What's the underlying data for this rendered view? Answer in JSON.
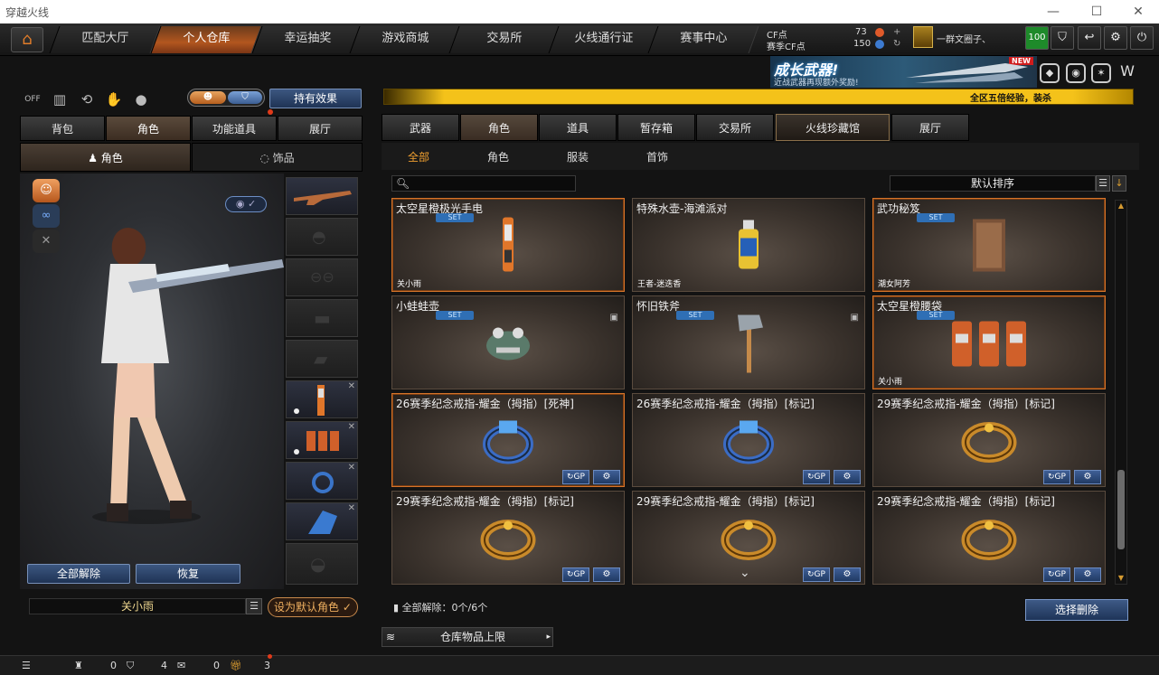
{
  "window": {
    "title": "穿越火线"
  },
  "nav": {
    "tabs": [
      "匹配大厅",
      "个人仓库",
      "幸运抽奖",
      "游戏商城",
      "交易所",
      "火线通行证",
      "赛事中心"
    ],
    "active": 1
  },
  "currency": {
    "cf_label": "CF点",
    "cf_value": "73",
    "season_label": "赛季CF点",
    "season_value": "150"
  },
  "user": {
    "name": "一群文圈子、",
    "level": "100"
  },
  "banner": {
    "title": "成长武器!",
    "subtitle": "近战武器再现额外奖励!",
    "badge": "NEW"
  },
  "marquee": {
    "text": "全区五倍经验，装杀"
  },
  "left": {
    "toggle_off": "OFF",
    "effects_button": "持有效果",
    "tabs": [
      "背包",
      "角色",
      "功能道具",
      "展厅"
    ],
    "active_tab": 1,
    "subtabs": [
      "角色",
      "饰品"
    ],
    "clear_all": "全部解除",
    "restore": "恢复",
    "character_name": "关小雨",
    "set_default": "设为默认角色"
  },
  "right": {
    "tabs": [
      "武器",
      "角色",
      "道具",
      "暂存箱",
      "交易所",
      "火线珍藏馆",
      "展厅"
    ],
    "active_tab": 1,
    "filters": [
      "全部",
      "角色",
      "服装",
      "首饰"
    ],
    "active_filter": 0,
    "sort_label": "默认排序",
    "clear_info": "全部解除：0个/6个",
    "select_delete": "选择删除",
    "warehouse_limit": "仓库物品上限"
  },
  "items": [
    {
      "name": "太空星橙极光手电",
      "set": "SET",
      "owner": "关小雨",
      "highlight": true,
      "art": "flashlight"
    },
    {
      "name": "特殊水壶-海滩派对",
      "set": "",
      "owner": "王者-迷迭香",
      "highlight": false,
      "art": "bottle"
    },
    {
      "name": "武功秘笈",
      "set": "SET",
      "owner": "潮女阿芳",
      "highlight": true,
      "art": "book"
    },
    {
      "name": "小蛙蛙壶",
      "set": "SET",
      "owner": "",
      "highlight": false,
      "lock": true,
      "art": "frog"
    },
    {
      "name": "怀旧铁斧",
      "set": "SET",
      "owner": "",
      "highlight": false,
      "lock": true,
      "art": "axe"
    },
    {
      "name": "太空星橙腰袋",
      "set": "SET",
      "owner": "关小雨",
      "highlight": true,
      "art": "pouch"
    },
    {
      "name": "26赛季纪念戒指-耀金（拇指）[死神]",
      "set": "",
      "owner": "",
      "highlight": true,
      "ring": true,
      "art": "ringblue"
    },
    {
      "name": "26赛季纪念戒指-耀金（拇指）[标记]",
      "set": "",
      "owner": "",
      "highlight": false,
      "ring": true,
      "art": "ringblue"
    },
    {
      "name": "29赛季纪念戒指-耀金（拇指）[标记]",
      "set": "",
      "owner": "",
      "highlight": false,
      "ring": true,
      "art": "ringgold"
    },
    {
      "name": "29赛季纪念戒指-耀金（拇指）[标记]",
      "set": "",
      "owner": "",
      "highlight": false,
      "ring": true,
      "art": "ringgold"
    },
    {
      "name": "29赛季纪念戒指-耀金（拇指）[标记]",
      "set": "",
      "owner": "",
      "highlight": false,
      "ring": true,
      "art": "ringgold"
    },
    {
      "name": "29赛季纪念戒指-耀金（拇指）[标记]",
      "set": "",
      "owner": "",
      "highlight": false,
      "ring": true,
      "art": "ringgold"
    }
  ],
  "status": {
    "v1": "0",
    "v2": "4",
    "v3": "0",
    "v4": "3"
  }
}
